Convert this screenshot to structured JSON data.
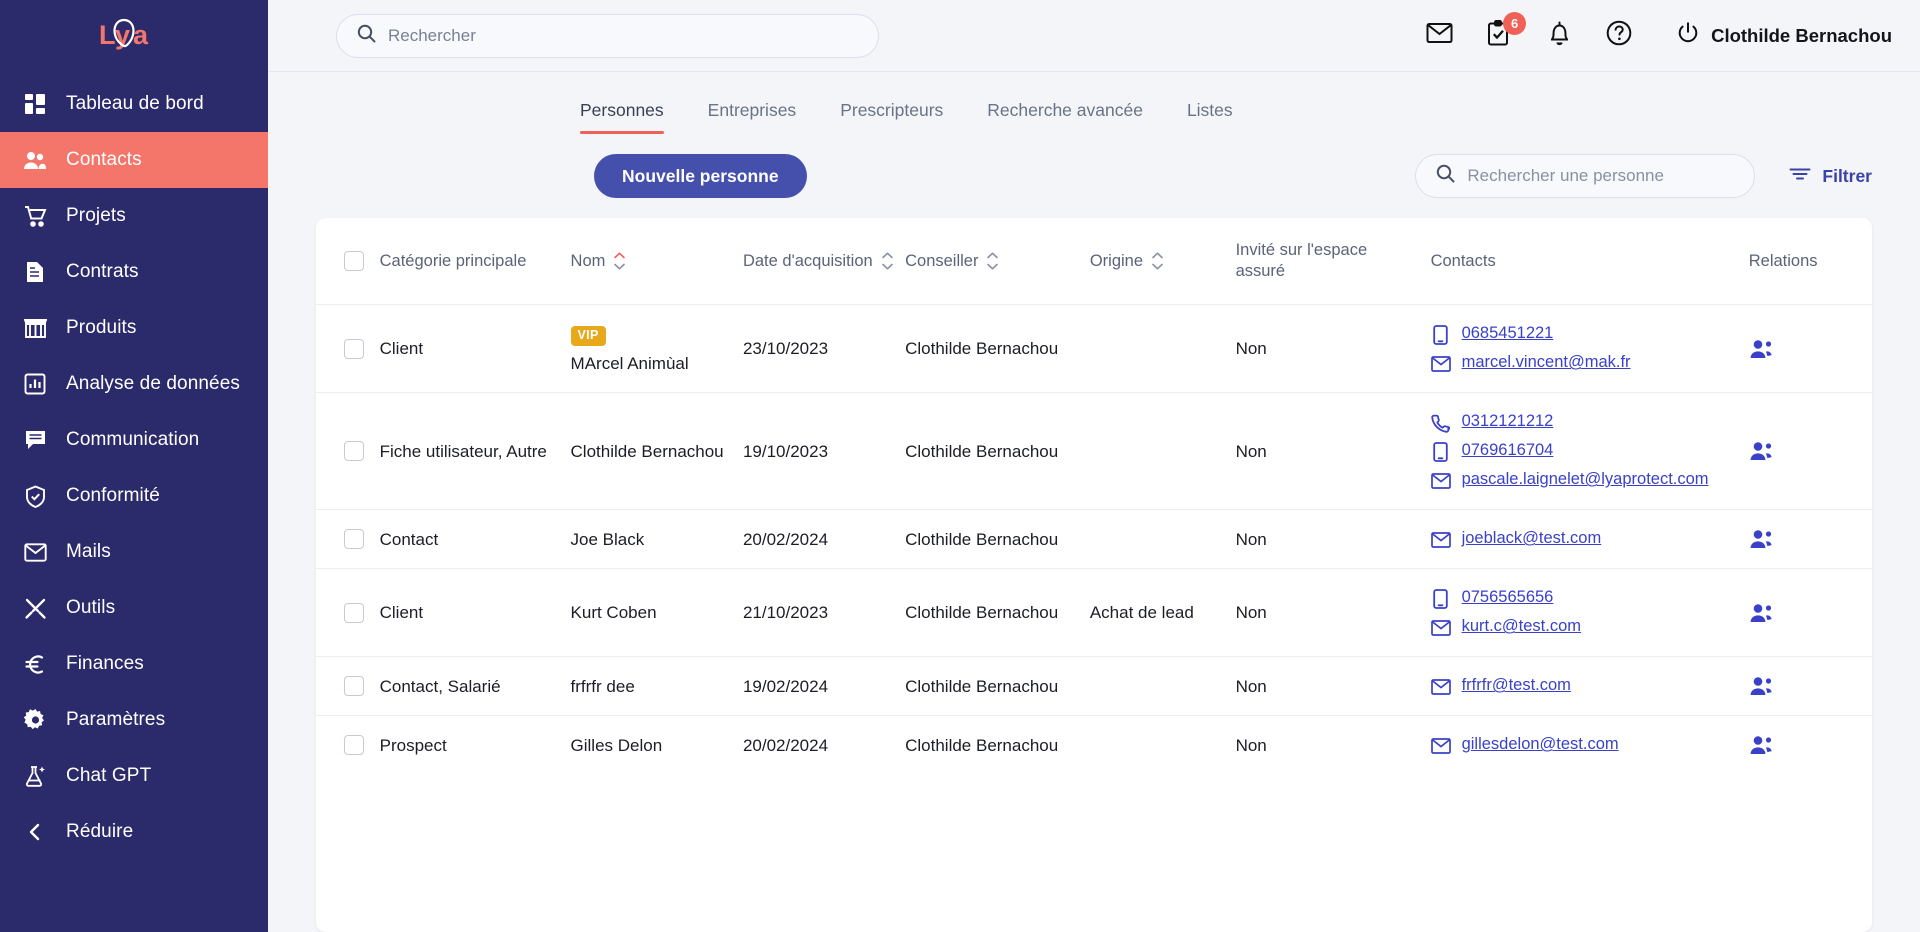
{
  "brand": {
    "logo_text": "Lya",
    "accent": "#ef6157",
    "sidebar_bg": "#2b2a6b",
    "primary": "#4550ad"
  },
  "sidebar": {
    "items": [
      {
        "label": "Tableau de bord",
        "icon": "dashboard-icon",
        "active": false
      },
      {
        "label": "Contacts",
        "icon": "contacts-icon",
        "active": true
      },
      {
        "label": "Projets",
        "icon": "cart-icon",
        "active": false
      },
      {
        "label": "Contrats",
        "icon": "document-icon",
        "active": false
      },
      {
        "label": "Produits",
        "icon": "store-icon",
        "active": false
      },
      {
        "label": "Analyse de données",
        "icon": "chart-icon",
        "active": false
      },
      {
        "label": "Communication",
        "icon": "chat-icon",
        "active": false
      },
      {
        "label": "Conformité",
        "icon": "shield-check-icon",
        "active": false
      },
      {
        "label": "Mails",
        "icon": "mail-icon",
        "active": false
      },
      {
        "label": "Outils",
        "icon": "tools-icon",
        "active": false
      },
      {
        "label": "Finances",
        "icon": "euro-icon",
        "active": false
      },
      {
        "label": "Paramètres",
        "icon": "gear-icon",
        "active": false
      },
      {
        "label": "Chat GPT",
        "icon": "flask-sparkle-icon",
        "active": false
      },
      {
        "label": "Réduire",
        "icon": "chevron-left-icon",
        "active": false
      }
    ]
  },
  "header": {
    "search": {
      "value": "",
      "placeholder": "Rechercher"
    },
    "icons": [
      {
        "name": "mail-icon",
        "badge": ""
      },
      {
        "name": "tasks-icon",
        "badge": "6"
      },
      {
        "name": "bell-icon",
        "badge": ""
      },
      {
        "name": "help-icon",
        "badge": ""
      }
    ],
    "user": {
      "name": "Clothilde Bernachou",
      "icon": "power-icon"
    }
  },
  "tabs": [
    {
      "label": "Personnes",
      "active": true
    },
    {
      "label": "Entreprises",
      "active": false
    },
    {
      "label": "Prescripteurs",
      "active": false
    },
    {
      "label": "Recherche avancée",
      "active": false
    },
    {
      "label": "Listes",
      "active": false
    }
  ],
  "actions": {
    "new_person_label": "Nouvelle personne",
    "search": {
      "value": "",
      "placeholder": "Rechercher une personne"
    },
    "filter_label": "Filtrer"
  },
  "table": {
    "columns": [
      {
        "key": "check",
        "label": "",
        "sortable": false
      },
      {
        "key": "category",
        "label": "Catégorie principale",
        "sortable": false
      },
      {
        "key": "name",
        "label": "Nom",
        "sortable": true,
        "sorted": "asc"
      },
      {
        "key": "date",
        "label": "Date d'acquisition",
        "sortable": true
      },
      {
        "key": "advisor",
        "label": "Conseiller",
        "sortable": true
      },
      {
        "key": "origin",
        "label": "Origine",
        "sortable": true
      },
      {
        "key": "invited",
        "label": "Invité sur l'espace assuré",
        "sortable": false
      },
      {
        "key": "contacts",
        "label": "Contacts",
        "sortable": false
      },
      {
        "key": "relations",
        "label": "Relations",
        "sortable": false
      }
    ],
    "rows": [
      {
        "category": "Client",
        "badge": "VIP",
        "name": "MArcel Animùal",
        "date": "23/10/2023",
        "advisor": "Clothilde Bernachou",
        "origin": "",
        "invited": "Non",
        "contacts": [
          {
            "type": "mobile-icon",
            "value": "0685451221"
          },
          {
            "type": "email-icon",
            "value": "marcel.vincent@mak.fr"
          }
        ],
        "relations": "relations-icon"
      },
      {
        "category": "Fiche utilisateur, Autre",
        "badge": "",
        "name": "Clothilde Bernachou",
        "date": "19/10/2023",
        "advisor": "Clothilde Bernachou",
        "origin": "",
        "invited": "Non",
        "contacts": [
          {
            "type": "phone-icon",
            "value": "0312121212"
          },
          {
            "type": "mobile-icon",
            "value": "0769616704"
          },
          {
            "type": "email-icon",
            "value": "pascale.laignelet@lyaprotect.com"
          }
        ],
        "relations": "relations-icon"
      },
      {
        "category": "Contact",
        "badge": "",
        "name": "Joe Black",
        "date": "20/02/2024",
        "advisor": "Clothilde Bernachou",
        "origin": "",
        "invited": "Non",
        "contacts": [
          {
            "type": "email-icon",
            "value": "joeblack@test.com"
          }
        ],
        "relations": "relations-icon"
      },
      {
        "category": "Client",
        "badge": "",
        "name": "Kurt Coben",
        "date": "21/10/2023",
        "advisor": "Clothilde Bernachou",
        "origin": "Achat de lead",
        "invited": "Non",
        "contacts": [
          {
            "type": "mobile-icon",
            "value": "0756565656"
          },
          {
            "type": "email-icon",
            "value": "kurt.c@test.com"
          }
        ],
        "relations": "relations-icon"
      },
      {
        "category": "Contact, Salarié",
        "badge": "",
        "name": "frfrfr dee",
        "date": "19/02/2024",
        "advisor": "Clothilde Bernachou",
        "origin": "",
        "invited": "Non",
        "contacts": [
          {
            "type": "email-icon",
            "value": "frfrfr@test.com"
          }
        ],
        "relations": "relations-icon"
      },
      {
        "category": "Prospect",
        "badge": "",
        "name": "Gilles Delon",
        "date": "20/02/2024",
        "advisor": "Clothilde Bernachou",
        "origin": "",
        "invited": "Non",
        "contacts": [
          {
            "type": "email-icon",
            "value": "gillesdelon@test.com"
          }
        ],
        "relations": "relations-icon"
      }
    ]
  }
}
